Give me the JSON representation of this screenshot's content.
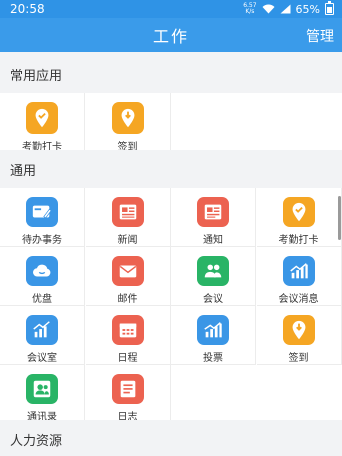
{
  "status": {
    "time": "20:58",
    "speed_top": "6.57",
    "speed_bottom": "K/s",
    "battery": "65%"
  },
  "header": {
    "title": "工作",
    "manage": "管理"
  },
  "sections": {
    "common": {
      "title": "常用应用",
      "items": [
        {
          "label": "考勤打卡",
          "icon": "location-check-icon",
          "color": "#f5a623"
        },
        {
          "label": "签到",
          "icon": "location-pin-icon",
          "color": "#f5a623"
        }
      ]
    },
    "general": {
      "title": "通用",
      "items": [
        {
          "label": "待办事务",
          "icon": "todo-card-icon",
          "color": "#3a96e6"
        },
        {
          "label": "新闻",
          "icon": "news-icon",
          "color": "#ec6250"
        },
        {
          "label": "通知",
          "icon": "notice-icon",
          "color": "#ec6250"
        },
        {
          "label": "考勤打卡",
          "icon": "location-check-icon",
          "color": "#f5a623"
        },
        {
          "label": "优盘",
          "icon": "cloud-icon",
          "color": "#3a96e6"
        },
        {
          "label": "邮件",
          "icon": "mail-icon",
          "color": "#ec6250"
        },
        {
          "label": "会议",
          "icon": "meeting-people-icon",
          "color": "#29b466"
        },
        {
          "label": "会议消息",
          "icon": "meeting-chart-icon",
          "color": "#3a96e6"
        },
        {
          "label": "会议室",
          "icon": "meeting-room-chart-icon",
          "color": "#3a96e6"
        },
        {
          "label": "日程",
          "icon": "calendar-icon",
          "color": "#ec6250"
        },
        {
          "label": "投票",
          "icon": "vote-chart-icon",
          "color": "#3a96e6"
        },
        {
          "label": "签到",
          "icon": "location-pin-icon",
          "color": "#f5a623"
        },
        {
          "label": "通讯录",
          "icon": "contacts-icon",
          "color": "#29b466"
        },
        {
          "label": "日志",
          "icon": "log-icon",
          "color": "#ec6250"
        }
      ]
    },
    "hr": {
      "title": "人力资源"
    }
  }
}
